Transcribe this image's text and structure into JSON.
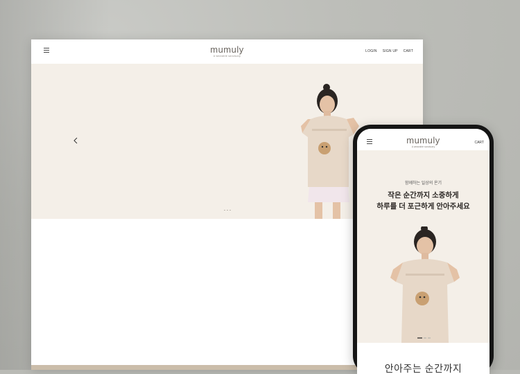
{
  "desktop": {
    "logo": "mumuly",
    "tagline": "A wearable sanctuary",
    "links": [
      "LOGIN",
      "SIGN UP",
      "CART"
    ]
  },
  "mobile": {
    "logo": "mumuly",
    "tagline": "A wearable sanctuary",
    "cart": "CART",
    "hero_sub": "함께하는 일상의 온기",
    "hero_line1": "작은 순간까지 소중하게",
    "hero_line2": "하루를 더 포근하게 안아주세요",
    "bottom_heading": "안아주는 순간까지"
  },
  "colors": {
    "hero_bg": "#f4efe8",
    "logo": "#6b6660",
    "wall": "#b9bab5",
    "strip": "#cbbdaa"
  },
  "icons": [
    "menu-icon",
    "chevron-left-icon"
  ]
}
